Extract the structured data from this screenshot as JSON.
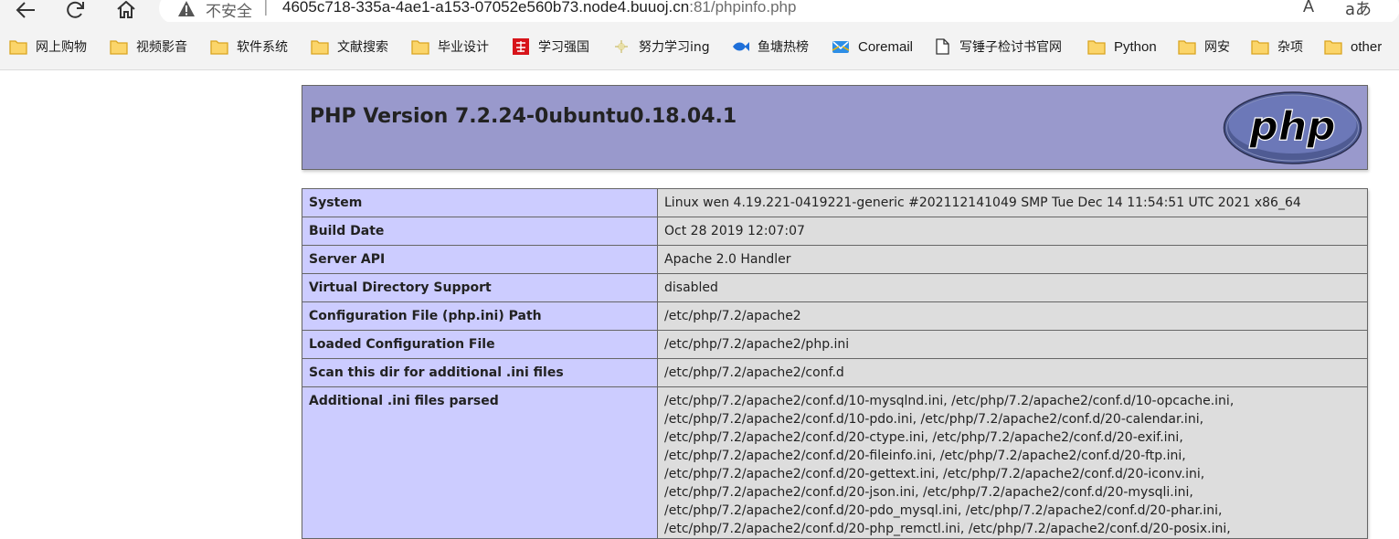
{
  "browser": {
    "insecure_label": "不安全",
    "separator": "|",
    "url_host": "4605c718-335a-4ae1-a153-07052e560b73.node4.buuoj.cn",
    "url_rest": ":81/phpinfo.php",
    "read_aloud_label": "A̅",
    "translate_label": "aあ",
    "icons": [
      "back-icon",
      "refresh-icon",
      "home-icon",
      "warning-icon"
    ]
  },
  "bookmarks": [
    {
      "label": "网上购物",
      "icon": "folder-icon"
    },
    {
      "label": "视频影音",
      "icon": "folder-icon"
    },
    {
      "label": "软件系统",
      "icon": "folder-icon"
    },
    {
      "label": "文献搜索",
      "icon": "folder-icon"
    },
    {
      "label": "毕业设计",
      "icon": "folder-icon"
    },
    {
      "label": "学习强国",
      "icon": "xuexi-icon"
    },
    {
      "label": "努力学习ing",
      "icon": "sparkle-icon"
    },
    {
      "label": "鱼塘热榜",
      "icon": "fish-icon"
    },
    {
      "label": "Coremail",
      "icon": "coremail-icon"
    },
    {
      "label": "写锤子检讨书官网",
      "icon": "page-icon"
    },
    {
      "label": "Python",
      "icon": "folder-icon"
    },
    {
      "label": "网安",
      "icon": "folder-icon"
    },
    {
      "label": "杂项",
      "icon": "folder-icon"
    },
    {
      "label": "other",
      "icon": "folder-icon"
    }
  ],
  "colors": {
    "header_bg": "#9999cc",
    "key_bg": "#ccccff",
    "value_bg": "#dddddd",
    "folder": "#f2c14e"
  },
  "php": {
    "title": "PHP Version 7.2.24-0ubuntu0.18.04.1",
    "logo_text": "php"
  },
  "info_rows": [
    {
      "key": "System",
      "value": "Linux wen 4.19.221-0419221-generic #202112141049 SMP Tue Dec 14 11:54:51 UTC 2021 x86_64"
    },
    {
      "key": "Build Date",
      "value": "Oct 28 2019 12:07:07"
    },
    {
      "key": "Server API",
      "value": "Apache 2.0 Handler"
    },
    {
      "key": "Virtual Directory Support",
      "value": "disabled"
    },
    {
      "key": "Configuration File (php.ini) Path",
      "value": "/etc/php/7.2/apache2"
    },
    {
      "key": "Loaded Configuration File",
      "value": "/etc/php/7.2/apache2/php.ini"
    },
    {
      "key": "Scan this dir for additional .ini files",
      "value": "/etc/php/7.2/apache2/conf.d"
    }
  ],
  "additional_ini": {
    "key": "Additional .ini files parsed",
    "lines": [
      "/etc/php/7.2/apache2/conf.d/10-mysqlnd.ini, /etc/php/7.2/apache2/conf.d/10-opcache.ini,",
      "/etc/php/7.2/apache2/conf.d/10-pdo.ini, /etc/php/7.2/apache2/conf.d/20-calendar.ini,",
      "/etc/php/7.2/apache2/conf.d/20-ctype.ini, /etc/php/7.2/apache2/conf.d/20-exif.ini,",
      "/etc/php/7.2/apache2/conf.d/20-fileinfo.ini, /etc/php/7.2/apache2/conf.d/20-ftp.ini,",
      "/etc/php/7.2/apache2/conf.d/20-gettext.ini, /etc/php/7.2/apache2/conf.d/20-iconv.ini,",
      "/etc/php/7.2/apache2/conf.d/20-json.ini, /etc/php/7.2/apache2/conf.d/20-mysqli.ini,",
      "/etc/php/7.2/apache2/conf.d/20-pdo_mysql.ini, /etc/php/7.2/apache2/conf.d/20-phar.ini,",
      "/etc/php/7.2/apache2/conf.d/20-php_remctl.ini, /etc/php/7.2/apache2/conf.d/20-posix.ini,"
    ]
  }
}
